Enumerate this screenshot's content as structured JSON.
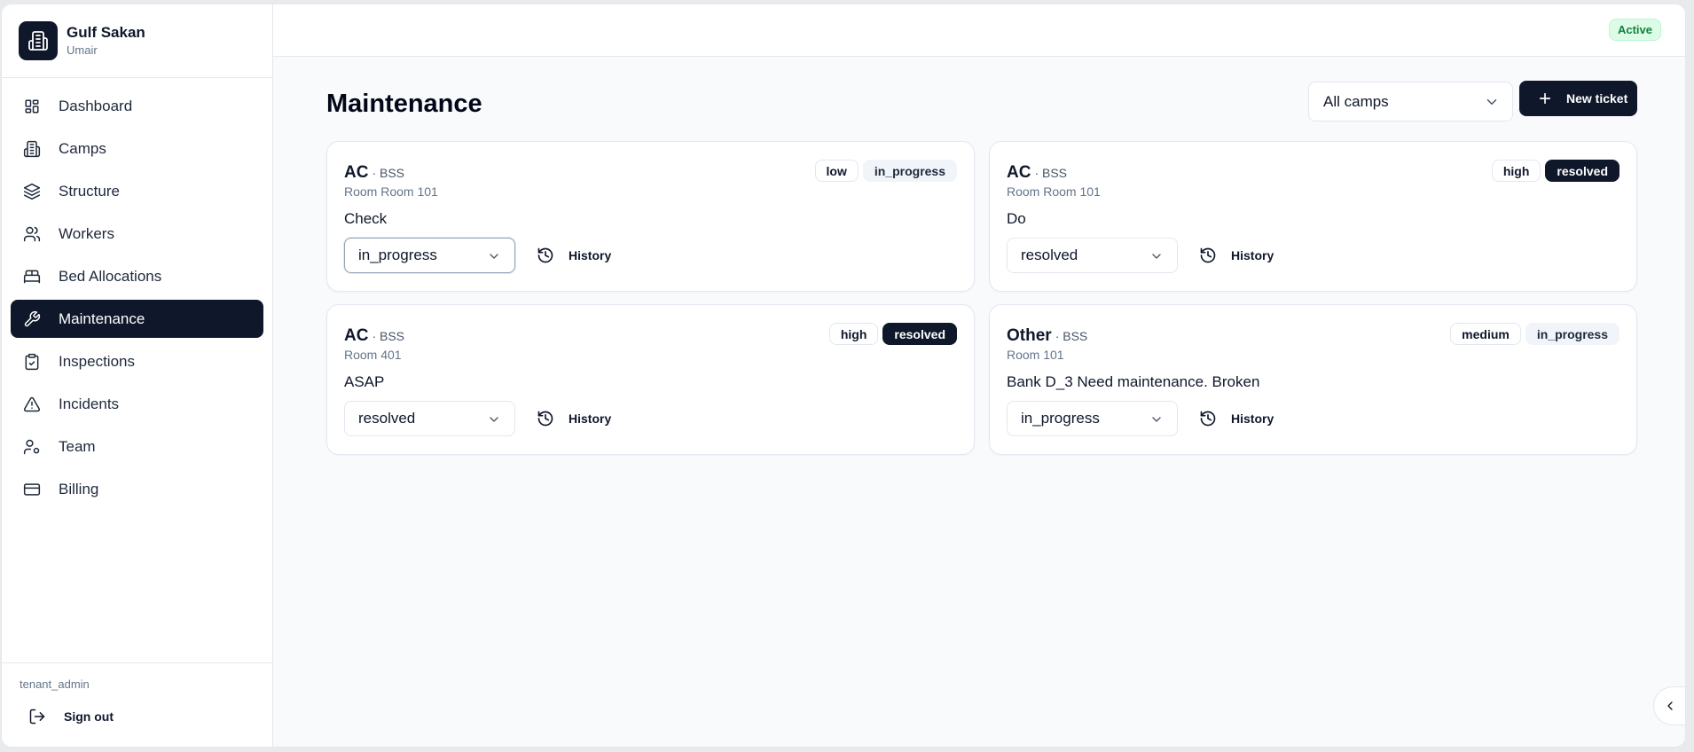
{
  "brand": {
    "name": "Gulf Sakan",
    "user": "Umair"
  },
  "nav": [
    {
      "label": "Dashboard",
      "icon": "dashboard-icon"
    },
    {
      "label": "Camps",
      "icon": "building-icon"
    },
    {
      "label": "Structure",
      "icon": "layers-icon"
    },
    {
      "label": "Workers",
      "icon": "users-icon"
    },
    {
      "label": "Bed Allocations",
      "icon": "bed-icon"
    },
    {
      "label": "Maintenance",
      "icon": "wrench-icon",
      "active": true
    },
    {
      "label": "Inspections",
      "icon": "clipboard-check-icon"
    },
    {
      "label": "Incidents",
      "icon": "alert-triangle-icon"
    },
    {
      "label": "Team",
      "icon": "user-cog-icon"
    },
    {
      "label": "Billing",
      "icon": "credit-card-icon"
    }
  ],
  "footer": {
    "role": "tenant_admin",
    "signout": "Sign out"
  },
  "topbar": {
    "status": "Active"
  },
  "page": {
    "title": "Maintenance",
    "camp_filter": "All camps",
    "new_ticket": "New ticket"
  },
  "tickets": [
    {
      "category": "AC",
      "camp": "· BSS",
      "room": "Room Room 101",
      "description": "Check",
      "priority": "low",
      "status_badge": "in_progress",
      "status_value": "in_progress",
      "history": "History"
    },
    {
      "category": "AC",
      "camp": "· BSS",
      "room": "Room Room 101",
      "description": "Do",
      "priority": "high",
      "status_badge": "resolved",
      "status_value": "resolved",
      "history": "History"
    },
    {
      "category": "AC",
      "camp": "· BSS",
      "room": "Room 401",
      "description": "ASAP",
      "priority": "high",
      "status_badge": "resolved",
      "status_value": "resolved",
      "history": "History"
    },
    {
      "category": "Other",
      "camp": "· BSS",
      "room": "Room 101",
      "description": "Bank D_3 Need maintenance. Broken",
      "priority": "medium",
      "status_badge": "in_progress",
      "status_value": "in_progress",
      "history": "History"
    }
  ],
  "colors": {
    "accent": "#0f172a",
    "active_badge_bg": "#dcfce7",
    "active_badge_text": "#15803d"
  }
}
